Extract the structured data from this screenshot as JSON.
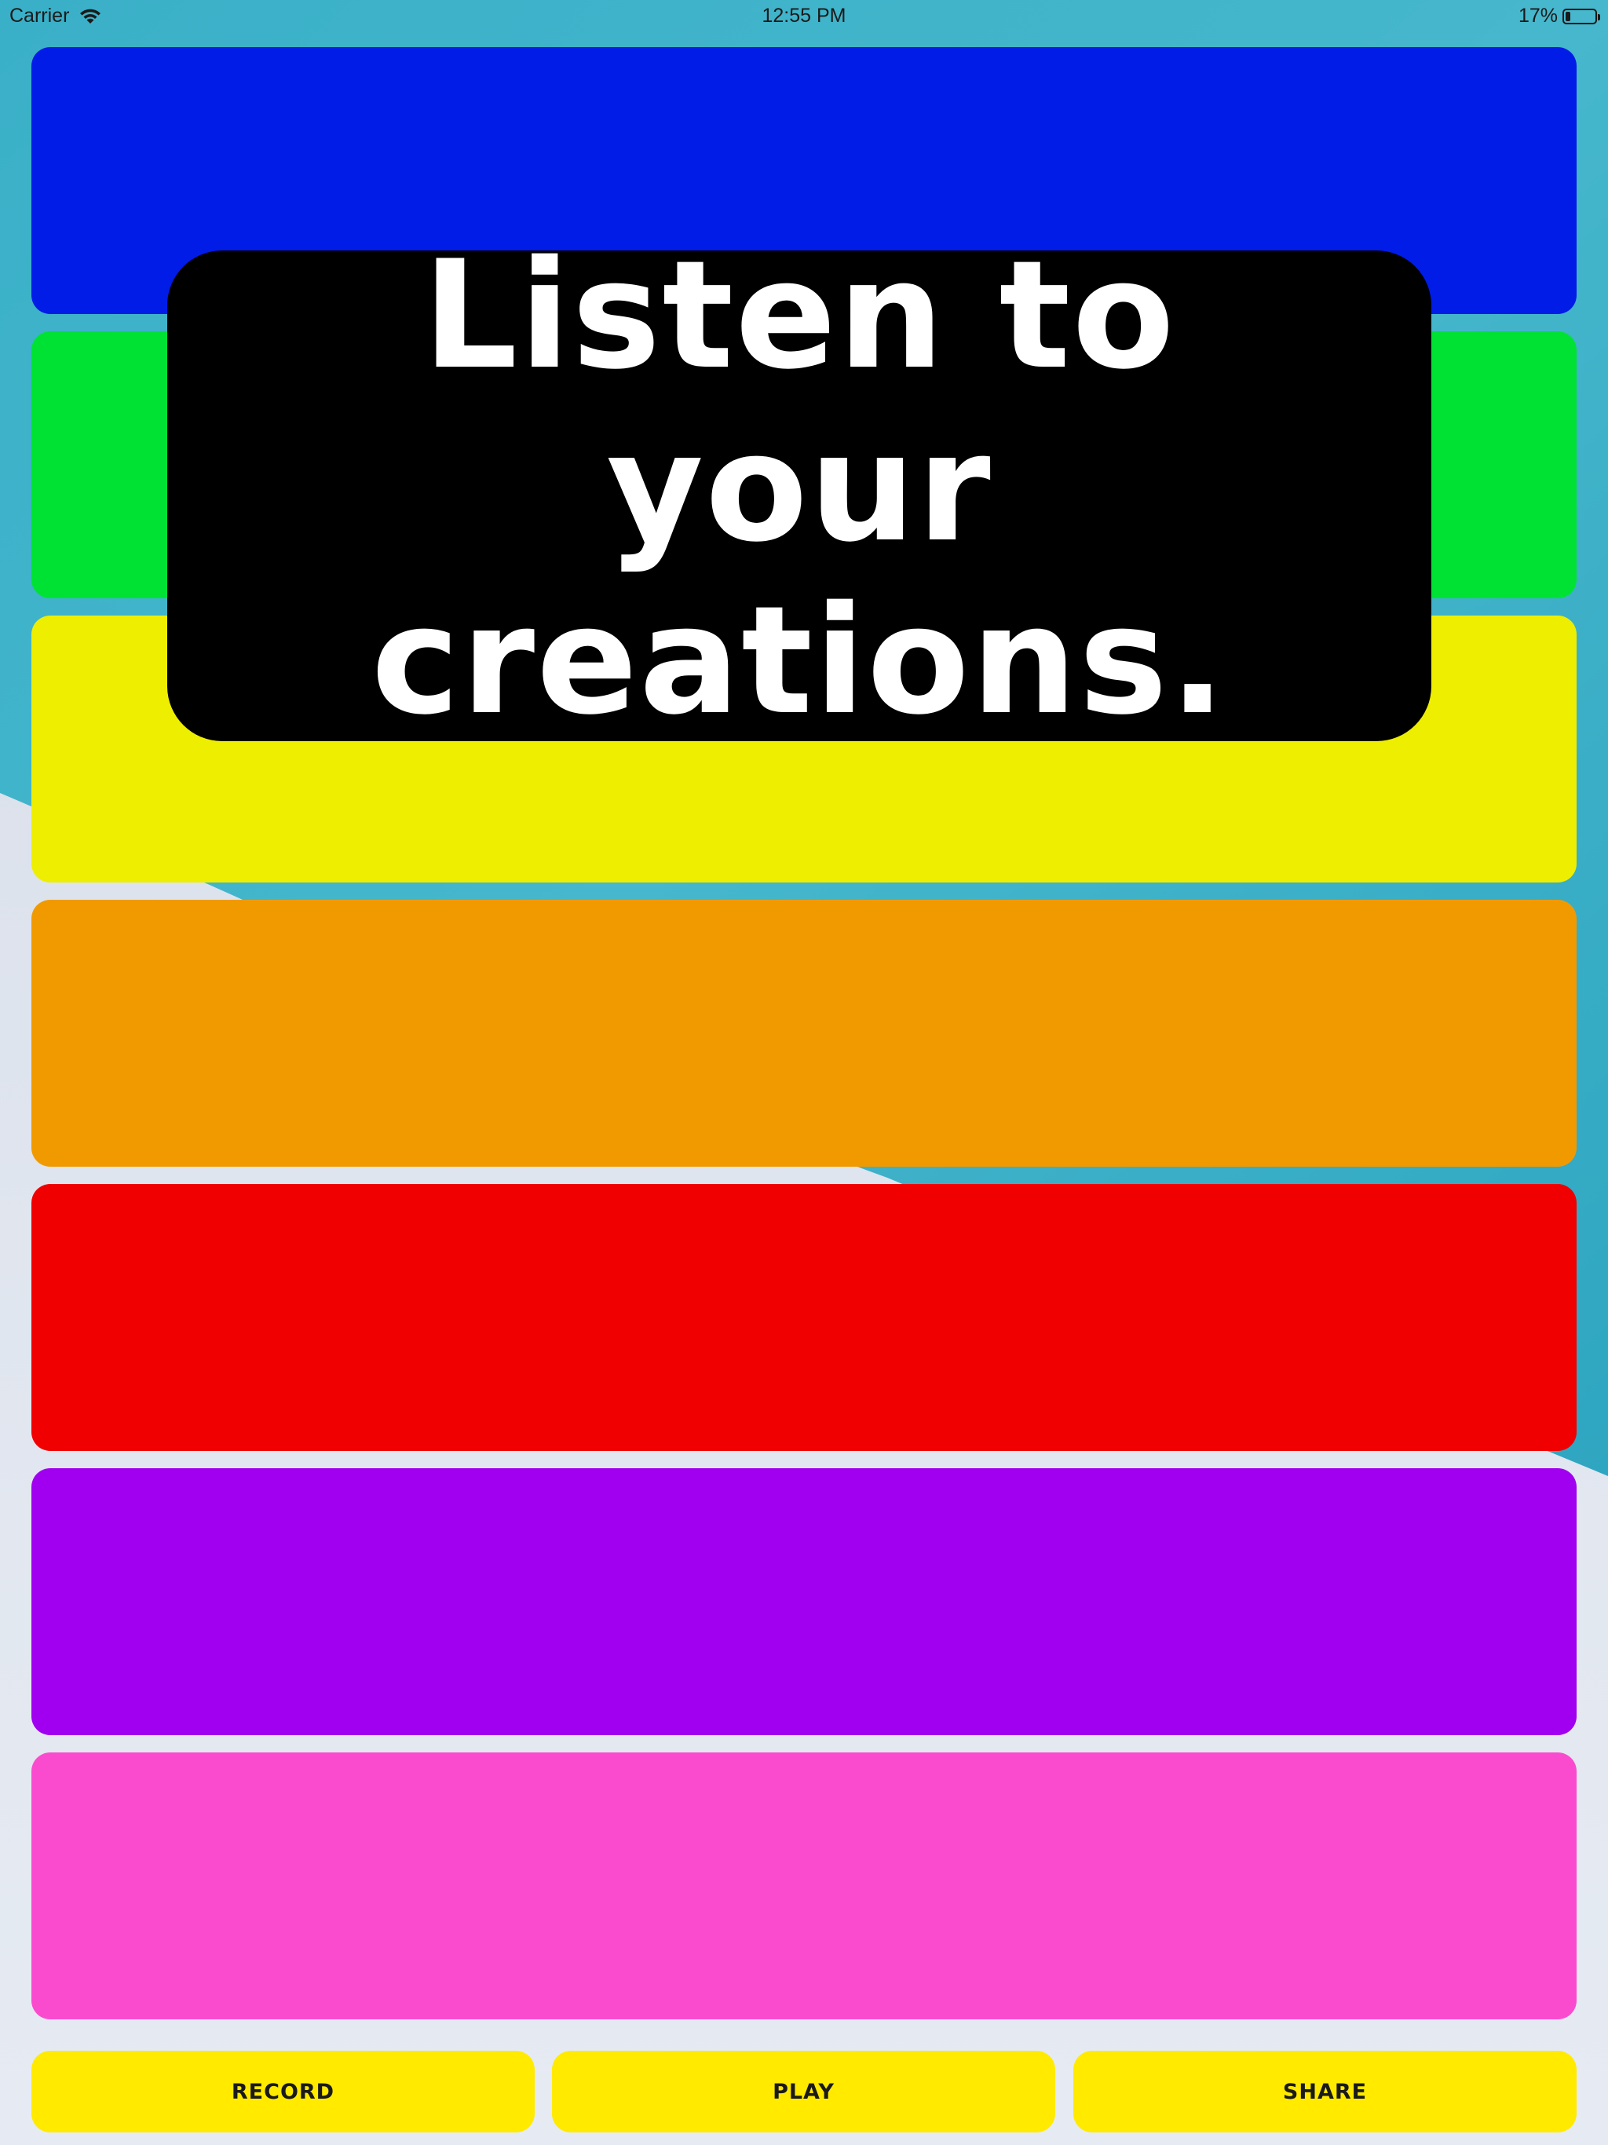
{
  "status_bar": {
    "carrier": "Carrier",
    "time": "12:55 PM",
    "battery": "17%",
    "battery_level": 0.17,
    "icons": [
      "wifi-icon",
      "battery-icon"
    ]
  },
  "bars": [
    {
      "name": "blue-bar",
      "color": "#001ce6"
    },
    {
      "name": "green-bar",
      "color": "#00e233"
    },
    {
      "name": "yellow-bar",
      "color": "#eeee00"
    },
    {
      "name": "orange-bar",
      "color": "#f09a00"
    },
    {
      "name": "red-bar",
      "color": "#f00000"
    },
    {
      "name": "purple-bar",
      "color": "#a000ef"
    },
    {
      "name": "pink-bar",
      "color": "#fa4bcf"
    }
  ],
  "overlay": {
    "line1": "Listen to your",
    "line2": "creations."
  },
  "buttons": {
    "record_label": "RECORD",
    "play_label": "PLAY",
    "share_label": "SHARE",
    "color": "#ffea00"
  },
  "colors": {
    "background_top": "#3fb2c8",
    "background_bottom": "#e3e8f0",
    "overlay": "#000000"
  }
}
